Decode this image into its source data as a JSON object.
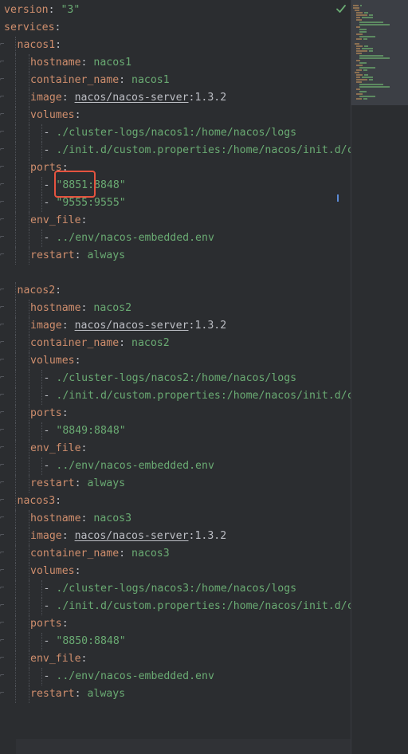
{
  "editor": {
    "status_icon": "check-icon",
    "lines": [
      {
        "indent": 0,
        "key": "version",
        "sep": ": ",
        "value": "\"3\"",
        "value_style": "v"
      },
      {
        "indent": 0,
        "key": "services",
        "sep": ":"
      },
      {
        "indent": 1,
        "key": "nacos1",
        "sep": ":"
      },
      {
        "indent": 2,
        "key": "hostname",
        "sep": ": ",
        "value": "nacos1",
        "value_style": "v"
      },
      {
        "indent": 2,
        "key": "container_name",
        "sep": ": ",
        "value": "nacos1",
        "value_style": "v"
      },
      {
        "indent": 2,
        "key": "image",
        "sep": ": ",
        "link": "nacos/nacos-server",
        "tail": ":1.3.2"
      },
      {
        "indent": 2,
        "key": "volumes",
        "sep": ":"
      },
      {
        "indent": 3,
        "dash": "- ",
        "value": "./cluster-logs/nacos1:/home/nacos/logs",
        "value_style": "v"
      },
      {
        "indent": 3,
        "dash": "- ",
        "value": "./init.d/custom.properties:/home/nacos/init.d/c",
        "value_style": "v"
      },
      {
        "indent": 2,
        "key": "ports",
        "sep": ":"
      },
      {
        "indent": 3,
        "dash": "- ",
        "value": "\"8851:8848\"",
        "value_style": "v"
      },
      {
        "indent": 3,
        "dash": "- ",
        "value": "\"9555:9555\"",
        "value_style": "v"
      },
      {
        "indent": 2,
        "key": "env_file",
        "sep": ":"
      },
      {
        "indent": 3,
        "dash": "- ",
        "value": "../env/nacos-embedded.env",
        "value_style": "v"
      },
      {
        "indent": 2,
        "key": "restart",
        "sep": ": ",
        "value": "always",
        "value_style": "v"
      },
      {
        "indent": 0,
        "blank": true
      },
      {
        "indent": 1,
        "key": "nacos2",
        "sep": ":"
      },
      {
        "indent": 2,
        "key": "hostname",
        "sep": ": ",
        "value": "nacos2",
        "value_style": "v"
      },
      {
        "indent": 2,
        "key": "image",
        "sep": ": ",
        "link": "nacos/nacos-server",
        "tail": ":1.3.2"
      },
      {
        "indent": 2,
        "key": "container_name",
        "sep": ": ",
        "value": "nacos2",
        "value_style": "v"
      },
      {
        "indent": 2,
        "key": "volumes",
        "sep": ":"
      },
      {
        "indent": 3,
        "dash": "- ",
        "value": "./cluster-logs/nacos2:/home/nacos/logs",
        "value_style": "v"
      },
      {
        "indent": 3,
        "dash": "- ",
        "value": "./init.d/custom.properties:/home/nacos/init.d/c",
        "value_style": "v"
      },
      {
        "indent": 2,
        "key": "ports",
        "sep": ":"
      },
      {
        "indent": 3,
        "dash": "- ",
        "value": "\"8849:8848\"",
        "value_style": "v"
      },
      {
        "indent": 2,
        "key": "env_file",
        "sep": ":"
      },
      {
        "indent": 3,
        "dash": "- ",
        "value": "../env/nacos-embedded.env",
        "value_style": "v"
      },
      {
        "indent": 2,
        "key": "restart",
        "sep": ": ",
        "value": "always",
        "value_style": "v"
      },
      {
        "indent": 1,
        "key": "nacos3",
        "sep": ":"
      },
      {
        "indent": 2,
        "key": "hostname",
        "sep": ": ",
        "value": "nacos3",
        "value_style": "v"
      },
      {
        "indent": 2,
        "key": "image",
        "sep": ": ",
        "link": "nacos/nacos-server",
        "tail": ":1.3.2"
      },
      {
        "indent": 2,
        "key": "container_name",
        "sep": ": ",
        "value": "nacos3",
        "value_style": "v"
      },
      {
        "indent": 2,
        "key": "volumes",
        "sep": ":"
      },
      {
        "indent": 3,
        "dash": "- ",
        "value": "./cluster-logs/nacos3:/home/nacos/logs",
        "value_style": "v"
      },
      {
        "indent": 3,
        "dash": "- ",
        "value": "./init.d/custom.properties:/home/nacos/init.d/c",
        "value_style": "v"
      },
      {
        "indent": 2,
        "key": "ports",
        "sep": ":"
      },
      {
        "indent": 3,
        "dash": "- ",
        "value": "\"8850:8848\"",
        "value_style": "v"
      },
      {
        "indent": 2,
        "key": "env_file",
        "sep": ":"
      },
      {
        "indent": 3,
        "dash": "- ",
        "value": "../env/nacos-embedded.env",
        "value_style": "v"
      },
      {
        "indent": 2,
        "key": "restart",
        "sep": ": ",
        "value": "always",
        "value_style": "v"
      }
    ]
  },
  "colors": {
    "background": "#2b2d30",
    "key": "#cf8e6d",
    "string": "#6aab73",
    "plain": "#bcbec4",
    "highlight_border": "#e5533f",
    "check": "#6aab73"
  }
}
